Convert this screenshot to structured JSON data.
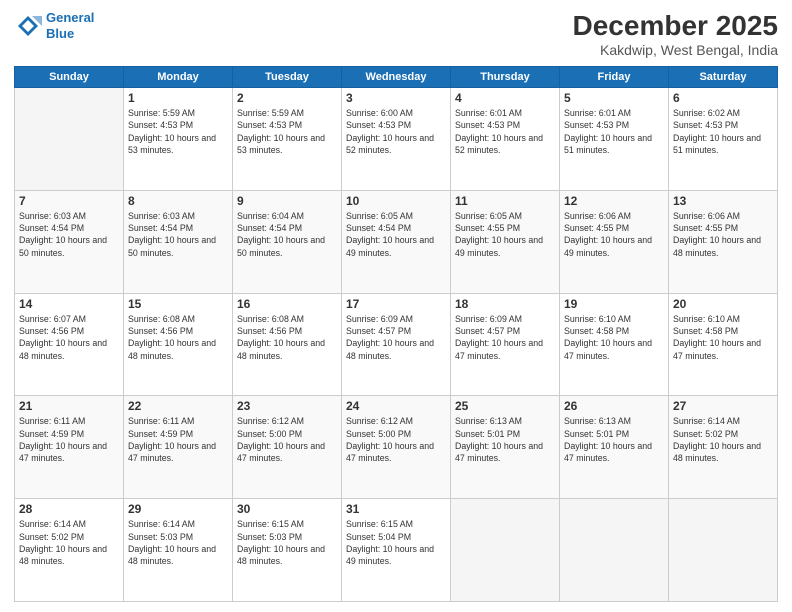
{
  "header": {
    "logo_line1": "General",
    "logo_line2": "Blue",
    "main_title": "December 2025",
    "subtitle": "Kakdwip, West Bengal, India"
  },
  "days_of_week": [
    "Sunday",
    "Monday",
    "Tuesday",
    "Wednesday",
    "Thursday",
    "Friday",
    "Saturday"
  ],
  "weeks": [
    [
      {
        "day": "",
        "sunrise": "",
        "sunset": "",
        "daylight": "",
        "empty": true
      },
      {
        "day": "1",
        "sunrise": "Sunrise: 5:59 AM",
        "sunset": "Sunset: 4:53 PM",
        "daylight": "Daylight: 10 hours and 53 minutes."
      },
      {
        "day": "2",
        "sunrise": "Sunrise: 5:59 AM",
        "sunset": "Sunset: 4:53 PM",
        "daylight": "Daylight: 10 hours and 53 minutes."
      },
      {
        "day": "3",
        "sunrise": "Sunrise: 6:00 AM",
        "sunset": "Sunset: 4:53 PM",
        "daylight": "Daylight: 10 hours and 52 minutes."
      },
      {
        "day": "4",
        "sunrise": "Sunrise: 6:01 AM",
        "sunset": "Sunset: 4:53 PM",
        "daylight": "Daylight: 10 hours and 52 minutes."
      },
      {
        "day": "5",
        "sunrise": "Sunrise: 6:01 AM",
        "sunset": "Sunset: 4:53 PM",
        "daylight": "Daylight: 10 hours and 51 minutes."
      },
      {
        "day": "6",
        "sunrise": "Sunrise: 6:02 AM",
        "sunset": "Sunset: 4:53 PM",
        "daylight": "Daylight: 10 hours and 51 minutes."
      }
    ],
    [
      {
        "day": "7",
        "sunrise": "Sunrise: 6:03 AM",
        "sunset": "Sunset: 4:54 PM",
        "daylight": "Daylight: 10 hours and 50 minutes."
      },
      {
        "day": "8",
        "sunrise": "Sunrise: 6:03 AM",
        "sunset": "Sunset: 4:54 PM",
        "daylight": "Daylight: 10 hours and 50 minutes."
      },
      {
        "day": "9",
        "sunrise": "Sunrise: 6:04 AM",
        "sunset": "Sunset: 4:54 PM",
        "daylight": "Daylight: 10 hours and 50 minutes."
      },
      {
        "day": "10",
        "sunrise": "Sunrise: 6:05 AM",
        "sunset": "Sunset: 4:54 PM",
        "daylight": "Daylight: 10 hours and 49 minutes."
      },
      {
        "day": "11",
        "sunrise": "Sunrise: 6:05 AM",
        "sunset": "Sunset: 4:55 PM",
        "daylight": "Daylight: 10 hours and 49 minutes."
      },
      {
        "day": "12",
        "sunrise": "Sunrise: 6:06 AM",
        "sunset": "Sunset: 4:55 PM",
        "daylight": "Daylight: 10 hours and 49 minutes."
      },
      {
        "day": "13",
        "sunrise": "Sunrise: 6:06 AM",
        "sunset": "Sunset: 4:55 PM",
        "daylight": "Daylight: 10 hours and 48 minutes."
      }
    ],
    [
      {
        "day": "14",
        "sunrise": "Sunrise: 6:07 AM",
        "sunset": "Sunset: 4:56 PM",
        "daylight": "Daylight: 10 hours and 48 minutes."
      },
      {
        "day": "15",
        "sunrise": "Sunrise: 6:08 AM",
        "sunset": "Sunset: 4:56 PM",
        "daylight": "Daylight: 10 hours and 48 minutes."
      },
      {
        "day": "16",
        "sunrise": "Sunrise: 6:08 AM",
        "sunset": "Sunset: 4:56 PM",
        "daylight": "Daylight: 10 hours and 48 minutes."
      },
      {
        "day": "17",
        "sunrise": "Sunrise: 6:09 AM",
        "sunset": "Sunset: 4:57 PM",
        "daylight": "Daylight: 10 hours and 48 minutes."
      },
      {
        "day": "18",
        "sunrise": "Sunrise: 6:09 AM",
        "sunset": "Sunset: 4:57 PM",
        "daylight": "Daylight: 10 hours and 47 minutes."
      },
      {
        "day": "19",
        "sunrise": "Sunrise: 6:10 AM",
        "sunset": "Sunset: 4:58 PM",
        "daylight": "Daylight: 10 hours and 47 minutes."
      },
      {
        "day": "20",
        "sunrise": "Sunrise: 6:10 AM",
        "sunset": "Sunset: 4:58 PM",
        "daylight": "Daylight: 10 hours and 47 minutes."
      }
    ],
    [
      {
        "day": "21",
        "sunrise": "Sunrise: 6:11 AM",
        "sunset": "Sunset: 4:59 PM",
        "daylight": "Daylight: 10 hours and 47 minutes."
      },
      {
        "day": "22",
        "sunrise": "Sunrise: 6:11 AM",
        "sunset": "Sunset: 4:59 PM",
        "daylight": "Daylight: 10 hours and 47 minutes."
      },
      {
        "day": "23",
        "sunrise": "Sunrise: 6:12 AM",
        "sunset": "Sunset: 5:00 PM",
        "daylight": "Daylight: 10 hours and 47 minutes."
      },
      {
        "day": "24",
        "sunrise": "Sunrise: 6:12 AM",
        "sunset": "Sunset: 5:00 PM",
        "daylight": "Daylight: 10 hours and 47 minutes."
      },
      {
        "day": "25",
        "sunrise": "Sunrise: 6:13 AM",
        "sunset": "Sunset: 5:01 PM",
        "daylight": "Daylight: 10 hours and 47 minutes."
      },
      {
        "day": "26",
        "sunrise": "Sunrise: 6:13 AM",
        "sunset": "Sunset: 5:01 PM",
        "daylight": "Daylight: 10 hours and 47 minutes."
      },
      {
        "day": "27",
        "sunrise": "Sunrise: 6:14 AM",
        "sunset": "Sunset: 5:02 PM",
        "daylight": "Daylight: 10 hours and 48 minutes."
      }
    ],
    [
      {
        "day": "28",
        "sunrise": "Sunrise: 6:14 AM",
        "sunset": "Sunset: 5:02 PM",
        "daylight": "Daylight: 10 hours and 48 minutes."
      },
      {
        "day": "29",
        "sunrise": "Sunrise: 6:14 AM",
        "sunset": "Sunset: 5:03 PM",
        "daylight": "Daylight: 10 hours and 48 minutes."
      },
      {
        "day": "30",
        "sunrise": "Sunrise: 6:15 AM",
        "sunset": "Sunset: 5:03 PM",
        "daylight": "Daylight: 10 hours and 48 minutes."
      },
      {
        "day": "31",
        "sunrise": "Sunrise: 6:15 AM",
        "sunset": "Sunset: 5:04 PM",
        "daylight": "Daylight: 10 hours and 49 minutes."
      },
      {
        "day": "",
        "sunrise": "",
        "sunset": "",
        "daylight": "",
        "empty": true
      },
      {
        "day": "",
        "sunrise": "",
        "sunset": "",
        "daylight": "",
        "empty": true
      },
      {
        "day": "",
        "sunrise": "",
        "sunset": "",
        "daylight": "",
        "empty": true
      }
    ]
  ]
}
